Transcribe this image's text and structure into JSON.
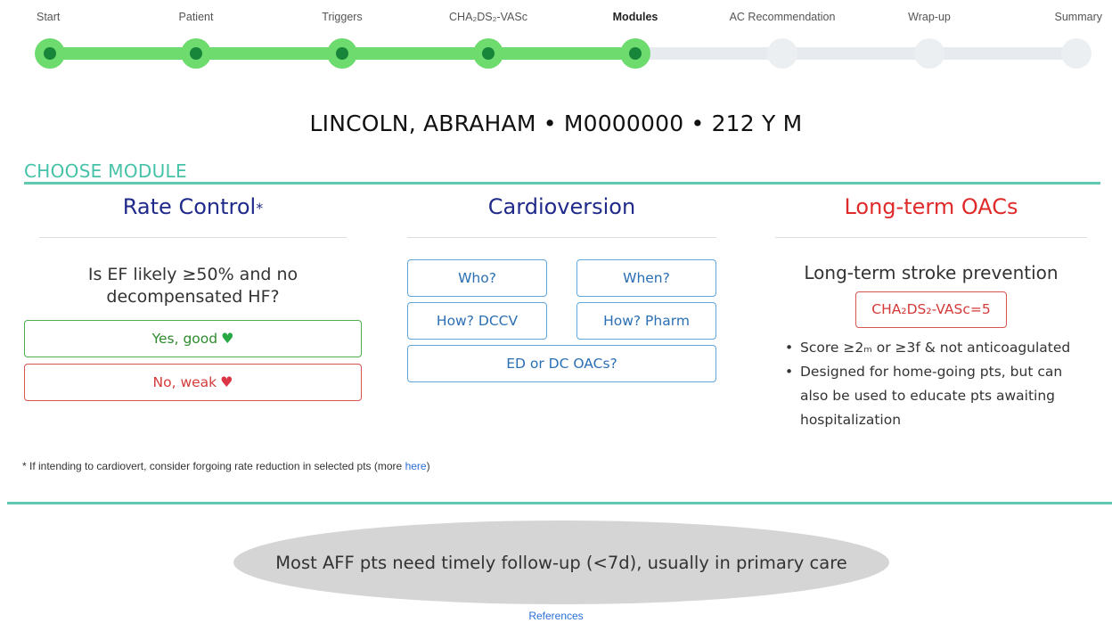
{
  "stepper": {
    "steps": [
      {
        "label": "Start",
        "state": "done"
      },
      {
        "label": "Patient",
        "state": "done"
      },
      {
        "label": "Triggers",
        "state": "done"
      },
      {
        "label": "CHA₂DS₂-VASc",
        "state": "done"
      },
      {
        "label": "Modules",
        "state": "current"
      },
      {
        "label": "AC Recommendation",
        "state": "todo"
      },
      {
        "label": "Wrap-up",
        "state": "todo"
      },
      {
        "label": "Summary",
        "state": "todo"
      }
    ]
  },
  "patient_banner": "LINCOLN, ABRAHAM • M0000000 •  212 Y M",
  "section_title": "CHOOSE MODULE",
  "rate_control": {
    "title": "Rate Control",
    "title_marker": "*",
    "question": "Is EF likely ≥50% and no decompensated HF?",
    "yes_label": "Yes, good",
    "no_label": "No, weak",
    "heart_icon": "heart-icon"
  },
  "cardioversion": {
    "title": "Cardioversion",
    "buttons": [
      "Who?",
      "When?",
      "How? DCCV",
      "How? Pharm",
      "ED or DC OACs?"
    ]
  },
  "long_term_oacs": {
    "title": "Long-term OACs",
    "subtitle": "Long-term stroke prevention",
    "score_label": "CHA₂DS₂-VASc=5",
    "bullets": [
      "Score ≥2ₘ or ≥3f & not anticoagulated",
      "Designed for home-going pts, but can also be used to educate pts awaiting hospitalization"
    ]
  },
  "footnote": {
    "text": "* If intending to cardiovert, consider forgoing rate reduction in selected pts (more ",
    "link": "here",
    "suffix": ")"
  },
  "follow_up": "Most AFF pts need timely follow-up (<7d), usually in primary care",
  "references_link": "References",
  "colors": {
    "accent_teal": "#5fc9b1",
    "progress_green": "#6ddb6d",
    "node_dark_green": "#17853a",
    "navy": "#1f2a8a",
    "danger_red": "#d9534f",
    "info_blue": "#5fa6d9",
    "success_green": "#4cae4c"
  }
}
